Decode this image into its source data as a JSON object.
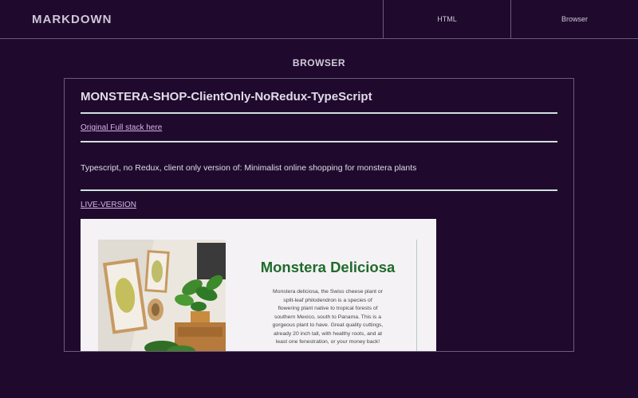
{
  "header": {
    "brand": "MARKDOWN",
    "tabs": [
      {
        "label": "HTML"
      },
      {
        "label": "Browser"
      }
    ]
  },
  "section": {
    "title": "BROWSER"
  },
  "readme": {
    "title": "MONSTERA-SHOP-ClientOnly-NoRedux-TypeScript",
    "original_link": "Original Full stack here",
    "description": "Typescript, no Redux, client only version of: Minimalist online shopping for monstera plants",
    "live_link": "LIVE-VERSION"
  },
  "preview": {
    "product_title": "Monstera Deliciosa",
    "product_description": "Monstera deliciosa, the Swiss cheese plant or split-leaf philodendron is a species of flowering plant native to tropical forests of southern Mexico, south to Panama. This is a gorgeous plant to have. Great quality cuttings, already 20 inch tall, with healthy roots, and at least one fenestration, or your money back!"
  },
  "colors": {
    "background": "#1f0a2e",
    "accent_link": "#d6b3e6",
    "product_green": "#1f6b2b"
  }
}
